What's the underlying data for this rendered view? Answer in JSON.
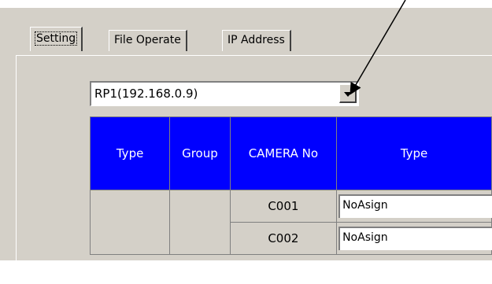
{
  "tabs": [
    "Setting",
    "File Operate",
    "IP Address"
  ],
  "recorder_select": {
    "value": "RP1(192.168.0.9)"
  },
  "table": {
    "headers": [
      "Type",
      "Group",
      "CAMERA No",
      "Type"
    ],
    "rows": [
      {
        "camera_no": "C001",
        "type": "NoAsign"
      },
      {
        "camera_no": "C002",
        "type": "NoAsign"
      }
    ]
  },
  "colors": {
    "header_bg": "#0000ff",
    "window_bg": "#d4d0c8"
  },
  "icons": {
    "arrow": "annotation-arrow-icon",
    "dropdown": "chevron-down-icon"
  }
}
